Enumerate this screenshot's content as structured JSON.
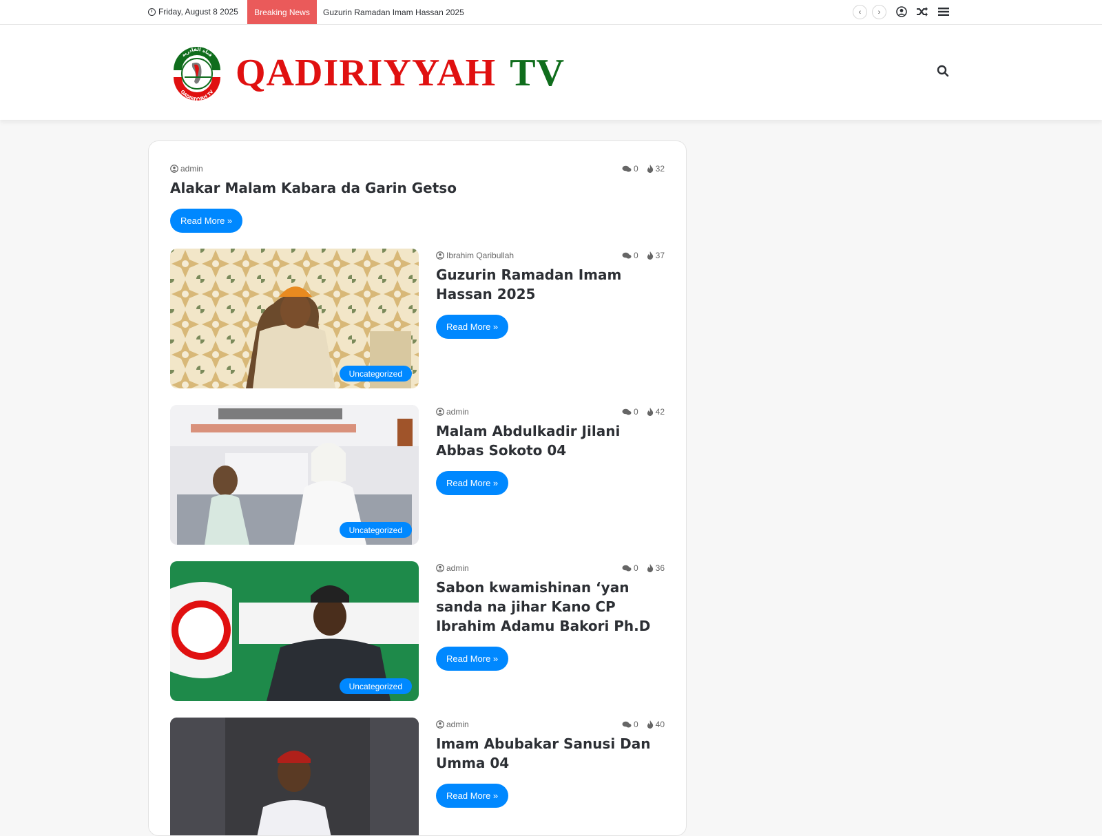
{
  "topbar": {
    "date": "Friday, August 8 2025",
    "breaking_label": "Breaking News",
    "ticker_text": "Guzurin Ramadan Imam Hassan 2025"
  },
  "header": {
    "logo_word1": "QADIRIYYAH",
    "logo_word2": "TV",
    "emblem_arabic": "قناة القادرية",
    "emblem_latin": "QADIRIYYAH TV"
  },
  "colors": {
    "accent": "#0088ff",
    "breaking": "#ea5a5a",
    "logo_red": "#e01010",
    "logo_green": "#0f6d1c"
  },
  "posts": [
    {
      "author": "admin",
      "comments": "0",
      "views": "32",
      "title": "Alakar Malam Kabara da Garin Getso",
      "button": "Read More »"
    },
    {
      "author": "Ibrahim Qaribullah",
      "comments": "0",
      "views": "37",
      "title": "Guzurin Ramadan Imam Hassan 2025",
      "button": "Read More »",
      "category": "Uncategorized"
    },
    {
      "author": "admin",
      "comments": "0",
      "views": "42",
      "title": "Malam Abdulkadir Jilani Abbas Sokoto 04",
      "button": "Read More »",
      "category": "Uncategorized"
    },
    {
      "author": "admin",
      "comments": "0",
      "views": "36",
      "title": "Sabon kwamishinan ‘yan sanda na jihar Kano CP Ibrahim Adamu Bakori Ph.D",
      "button": "Read More »",
      "category": "Uncategorized"
    },
    {
      "author": "admin",
      "comments": "0",
      "views": "40",
      "title": "Imam Abubakar Sanusi Dan Umma 04",
      "button": "Read More »"
    }
  ]
}
